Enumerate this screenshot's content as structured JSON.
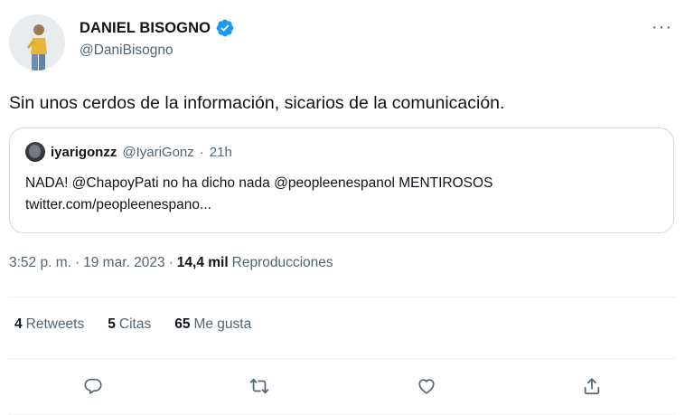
{
  "author": {
    "display_name": "DANIEL BISOGNO",
    "handle": "@DaniBisogno",
    "verified": true
  },
  "tweet_text": "Sin unos cerdos de la información, sicarios de la comunicación.",
  "quoted_tweet": {
    "name": "iyarigonzz",
    "handle": "@IyariGonz",
    "separator": "·",
    "time": "21h",
    "text_line1": "NADA! @ChapoyPati no ha dicho nada @peopleenespanol MENTIROSOS",
    "text_line2": "twitter.com/peopleenespano..."
  },
  "meta": {
    "time": "3:52 p. m.",
    "sep1": "·",
    "date": "19 mar. 2023",
    "sep2": "·",
    "views_count": "14,4 mil",
    "views_label": "Reproducciones"
  },
  "stats": {
    "retweets_count": "4",
    "retweets_label": "Retweets",
    "quotes_count": "5",
    "quotes_label": "Citas",
    "likes_count": "65",
    "likes_label": "Me gusta"
  },
  "more_menu": "···",
  "icons": {
    "verified": "verified-badge-icon",
    "reply": "reply-icon",
    "retweet": "retweet-icon",
    "like": "heart-icon",
    "share": "share-icon"
  },
  "colors": {
    "verified": "#1d9bf0",
    "text_primary": "#0f1419",
    "text_secondary": "#536471",
    "border": "#cfd9de"
  }
}
